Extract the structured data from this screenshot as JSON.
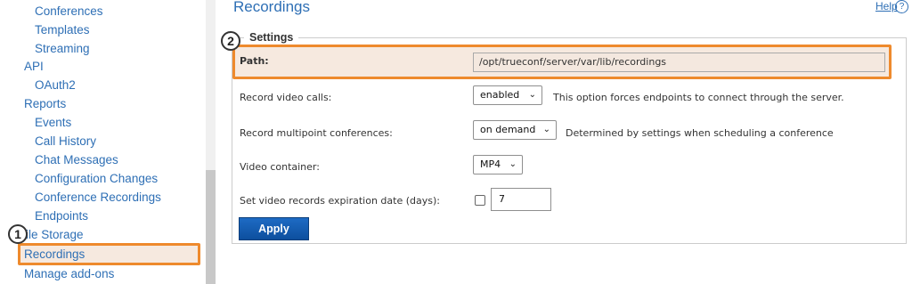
{
  "sidebar": {
    "items": [
      {
        "label": "Conferences"
      },
      {
        "label": "Templates"
      },
      {
        "label": "Streaming"
      },
      {
        "label": "API"
      },
      {
        "label": "OAuth2"
      },
      {
        "label": "Reports"
      },
      {
        "label": "Events"
      },
      {
        "label": "Call History"
      },
      {
        "label": "Chat Messages"
      },
      {
        "label": "Configuration Changes"
      },
      {
        "label": "Conference Recordings"
      },
      {
        "label": "Endpoints"
      },
      {
        "label": "File Storage"
      },
      {
        "label": "Recordings"
      },
      {
        "label": "Manage add-ons"
      }
    ],
    "file_storage_visible": "ile Storage"
  },
  "badges": {
    "one": "1",
    "two": "2"
  },
  "header": {
    "title": "Recordings",
    "help_label": "Help",
    "help_icon": "?"
  },
  "settings": {
    "legend": "Settings",
    "path_label": "Path:",
    "path_value": "/opt/trueconf/server/var/lib/recordings",
    "record_video_calls_label": "Record video calls:",
    "record_video_calls_value": "enabled",
    "record_video_calls_hint": "This option forces endpoints to connect through the server.",
    "record_multipoint_label": "Record multipoint conferences:",
    "record_multipoint_value": "on demand",
    "record_multipoint_hint": "Determined by settings when scheduling a conference",
    "video_container_label": "Video container:",
    "video_container_value": "MP4",
    "expiration_label": "Set video records expiration date (days):",
    "expiration_checked": false,
    "expiration_value": "7",
    "apply_label": "Apply"
  },
  "colors": {
    "link": "#2e6fb5",
    "highlight_border": "#ee8a2d",
    "highlight_bg": "#f6e9df",
    "button": "#1560b8"
  }
}
